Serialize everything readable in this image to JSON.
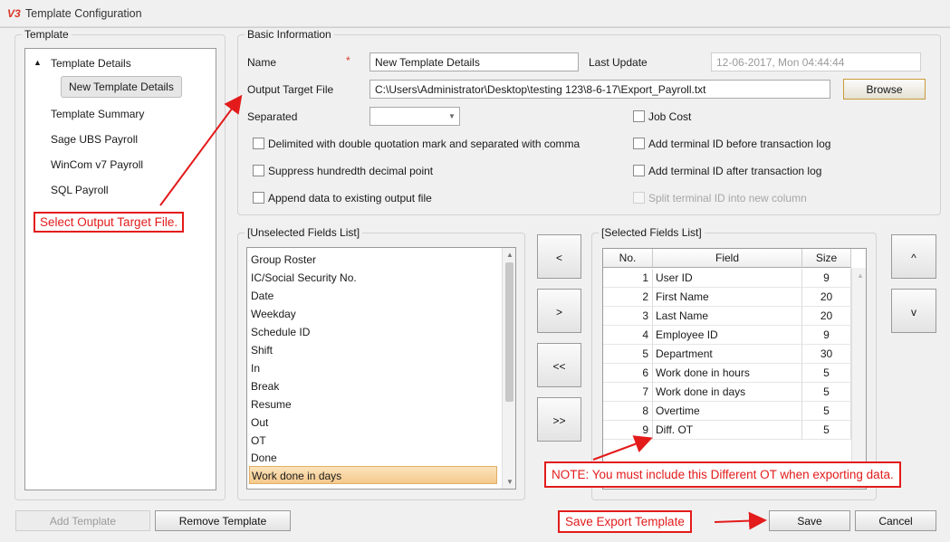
{
  "window": {
    "icon_text": "V3",
    "title": "Template Configuration"
  },
  "template_panel": {
    "title": "Template",
    "tree": [
      {
        "label": "Template Details",
        "expander": "▲"
      },
      {
        "label": "New Template Details"
      },
      {
        "label": "Template Summary"
      },
      {
        "label": "Sage UBS Payroll"
      },
      {
        "label": "WinCom v7 Payroll"
      },
      {
        "label": "SQL Payroll"
      }
    ]
  },
  "basic_info": {
    "title": "Basic Information",
    "name_label": "Name",
    "required_mark": "*",
    "name_value": "New Template Details",
    "last_update_label": "Last Update",
    "last_update_value": "12-06-2017, Mon  04:44:44",
    "output_label": "Output Target File",
    "output_value": "C:\\Users\\Administrator\\Desktop\\testing 123\\8-6-17\\Export_Payroll.txt",
    "browse_label": "Browse",
    "separated_label": "Separated",
    "separated_value": "",
    "checkboxes": [
      {
        "label": "Job Cost",
        "checked": false,
        "enabled": true
      },
      {
        "label": "Delimited with double quotation mark and separated with comma",
        "checked": false,
        "enabled": true
      },
      {
        "label": "Add terminal ID before transaction log",
        "checked": false,
        "enabled": true
      },
      {
        "label": "Suppress hundredth decimal point",
        "checked": false,
        "enabled": true
      },
      {
        "label": "Add terminal ID after transaction log",
        "checked": false,
        "enabled": true
      },
      {
        "label": "Append data to existing output file",
        "checked": false,
        "enabled": true
      },
      {
        "label": "Split terminal ID into new column",
        "checked": false,
        "enabled": false
      }
    ]
  },
  "unselected": {
    "title": "[Unselected Fields List]",
    "items": [
      "Group Roster",
      "IC/Social Security No.",
      "Date",
      "Weekday",
      "Schedule ID",
      "Shift",
      "In",
      "Break",
      "Resume",
      "Out",
      "OT",
      "Done",
      "Work done in days"
    ],
    "selected_index": 12
  },
  "move_buttons": [
    "<",
    ">",
    "<<",
    ">>"
  ],
  "selected": {
    "title": "[Selected Fields List]",
    "headers": [
      "No.",
      "Field",
      "Size"
    ],
    "rows": [
      {
        "no": "1",
        "field": "User ID",
        "size": "9"
      },
      {
        "no": "2",
        "field": "First Name",
        "size": "20"
      },
      {
        "no": "3",
        "field": "Last Name",
        "size": "20"
      },
      {
        "no": "4",
        "field": "Employee ID",
        "size": "9"
      },
      {
        "no": "5",
        "field": "Department",
        "size": "30"
      },
      {
        "no": "6",
        "field": "Work done in hours",
        "size": "5"
      },
      {
        "no": "7",
        "field": "Work done in days",
        "size": "5"
      },
      {
        "no": "8",
        "field": "Overtime",
        "size": "5"
      },
      {
        "no": "9",
        "field": "Diff. OT",
        "size": "5"
      }
    ]
  },
  "order_buttons": [
    "^",
    "v"
  ],
  "bottom_buttons": {
    "add_template": "Add Template",
    "remove_template": "Remove Template",
    "save": "Save",
    "cancel": "Cancel"
  },
  "annotations": {
    "select_output": "Select Output Target File.",
    "note": "NOTE: You must include this Different OT when exporting data.",
    "save_export": "Save Export Template"
  },
  "colors": {
    "annotation": "#e31b1b",
    "selection": "#f5c98c",
    "app_icon": "#d9382b"
  }
}
